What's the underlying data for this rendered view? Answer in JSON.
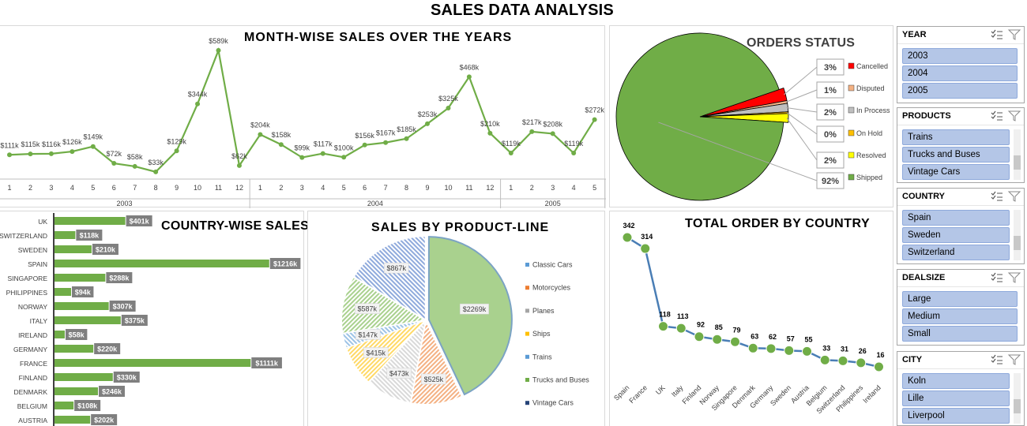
{
  "title": "SALES DATA ANALYSIS",
  "chart_data": [
    {
      "id": "monthly",
      "type": "line",
      "title": "MONTH-WISE SALES OVER THE YEARS",
      "years": [
        {
          "label": "2003",
          "months": [
            "1",
            "2",
            "3",
            "4",
            "5",
            "6",
            "7",
            "8",
            "9",
            "10",
            "11",
            "12"
          ]
        },
        {
          "label": "2004",
          "months": [
            "1",
            "2",
            "3",
            "4",
            "5",
            "6",
            "7",
            "8",
            "9",
            "10",
            "11",
            "12"
          ]
        },
        {
          "label": "2005",
          "months": [
            "1",
            "2",
            "3",
            "4",
            "5"
          ]
        }
      ],
      "values": [
        111,
        115,
        116,
        126,
        149,
        72,
        58,
        33,
        129,
        344,
        589,
        62,
        204,
        158,
        99,
        117,
        100,
        156,
        167,
        185,
        253,
        325,
        468,
        210,
        119,
        217,
        208,
        119,
        272
      ],
      "labels": [
        "$111k",
        "$115k",
        "$116k",
        "$126k",
        "$149k",
        "$72k",
        "$58k",
        "$33k",
        "$129k",
        "$344k",
        "$589k",
        "$62k",
        "$204k",
        "$158k",
        "$99k",
        "$117k",
        "$100k",
        "$156k",
        "$167k",
        "$185k",
        "$253k",
        "$325k",
        "$468k",
        "$210k",
        "$119k",
        "$217k",
        "$208k",
        "$119k",
        "$272k"
      ],
      "color": "#70ad47"
    },
    {
      "id": "orders",
      "type": "pie",
      "title": "ORDERS STATUS",
      "slices": [
        {
          "name": "Cancelled",
          "value": 2.3,
          "label": "3%",
          "color": "#ff0000"
        },
        {
          "name": "Disputed",
          "value": 0.5,
          "label": "1%",
          "color": "#f4b183"
        },
        {
          "name": "In Process",
          "value": 1.5,
          "label": "2%",
          "color": "#bfbfbf"
        },
        {
          "name": "On Hold",
          "value": 0.3,
          "label": "0%",
          "color": "#ffc000"
        },
        {
          "name": "Resolved",
          "value": 1.6,
          "label": "2%",
          "color": "#ffff00"
        },
        {
          "name": "Shipped",
          "value": 92,
          "label": "92%",
          "color": "#70ad47"
        }
      ]
    },
    {
      "id": "country_sales",
      "type": "bar",
      "title": "COUNTRY-WISE SALES",
      "categories": [
        "UK",
        "SWITZERLAND",
        "SWEDEN",
        "SPAIN",
        "SINGAPORE",
        "PHILIPPINES",
        "NORWAY",
        "ITALY",
        "IRELAND",
        "GERMANY",
        "FRANCE",
        "FINLAND",
        "DENMARK",
        "BELGIUM",
        "AUSTRIA"
      ],
      "values": [
        401,
        118,
        210,
        1216,
        288,
        94,
        307,
        375,
        58,
        220,
        1111,
        330,
        246,
        108,
        202
      ],
      "labels": [
        "$401k",
        "$118k",
        "$210k",
        "$1216k",
        "$288k",
        "$94k",
        "$307k",
        "$375k",
        "$58k",
        "$220k",
        "$1111k",
        "$330k",
        "$246k",
        "$108k",
        "$202k"
      ],
      "color": "#70ad47"
    },
    {
      "id": "product_line",
      "type": "pie",
      "title": "SALES BY PRODUCT-LINE",
      "slices": [
        {
          "name": "Classic Cars",
          "value": 2269,
          "label": "$2269k",
          "color": "#a9d18e",
          "legend_color": "#5b9bd5"
        },
        {
          "name": "Motorcycles",
          "value": 525,
          "label": "$525k",
          "color": "#f4b183",
          "legend_color": "#ed7d31"
        },
        {
          "name": "Planes",
          "value": 473,
          "label": "$473k",
          "color": "#d9d9d9",
          "legend_color": "#a5a5a5"
        },
        {
          "name": "Ships",
          "value": 415,
          "label": "$415k",
          "color": "#ffd966",
          "legend_color": "#ffc000"
        },
        {
          "name": "Trains",
          "value": 147,
          "label": "$147k",
          "color": "#9dc3e6",
          "legend_color": "#5b9bd5"
        },
        {
          "name": "Trucks and Buses",
          "value": 587,
          "label": "$587k",
          "color": "#a9d18e",
          "legend_color": "#70ad47"
        },
        {
          "name": "Vintage Cars",
          "value": 867,
          "label": "$867k",
          "color": "#8faadc",
          "legend_color": "#264478"
        }
      ]
    },
    {
      "id": "orders_country",
      "type": "line",
      "title": "TOTAL ORDER BY COUNTRY",
      "categories": [
        "Spain",
        "France",
        "UK",
        "Italy",
        "Finland",
        "Norway",
        "Singapore",
        "Denmark",
        "Germany",
        "Sweden",
        "Austria",
        "Belgium",
        "Switzerland",
        "Philippines",
        "Ireland"
      ],
      "values": [
        342,
        314,
        118,
        113,
        92,
        85,
        79,
        63,
        62,
        57,
        55,
        33,
        31,
        26,
        16
      ],
      "line_color": "#4a7eb5",
      "marker_color": "#70ad47"
    }
  ],
  "slicers": [
    {
      "title": "YEAR",
      "items": [
        "2003",
        "2004",
        "2005"
      ],
      "scroll": false
    },
    {
      "title": "PRODUCTS",
      "items": [
        "Trains",
        "Trucks and Buses",
        "Vintage Cars"
      ],
      "scroll": true
    },
    {
      "title": "COUNTRY",
      "items": [
        "Spain",
        "Sweden",
        "Switzerland"
      ],
      "scroll": true
    },
    {
      "title": "DEALSIZE",
      "items": [
        "Large",
        "Medium",
        "Small"
      ],
      "scroll": false
    },
    {
      "title": "CITY",
      "items": [
        "Koln",
        "Lille",
        "Liverpool"
      ],
      "scroll": true
    }
  ],
  "slicer_icons": {
    "multi_select": "multi-select-icon",
    "clear_filter": "clear-filter-icon"
  }
}
